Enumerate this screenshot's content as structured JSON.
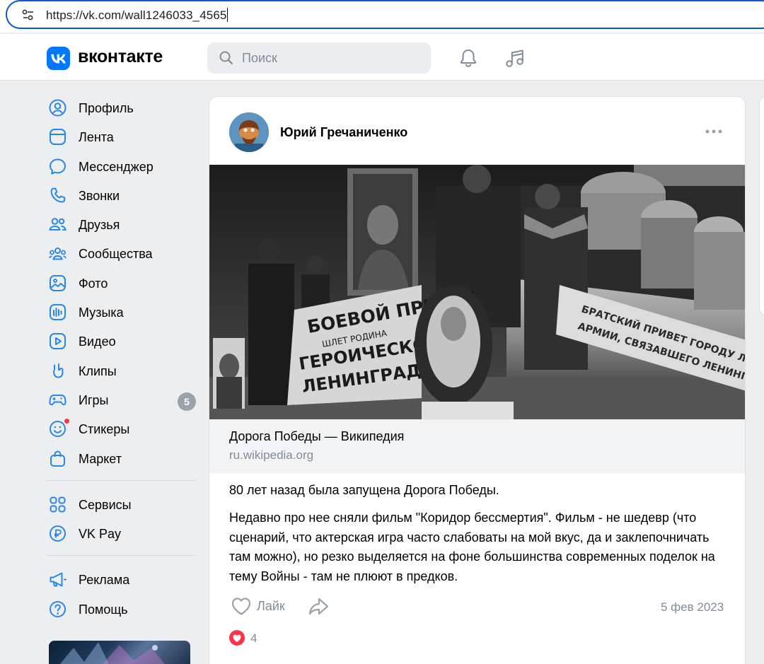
{
  "browser": {
    "url": "https://vk.com/wall1246033_4565"
  },
  "header": {
    "logo_text": "вконтакте",
    "search_placeholder": "Поиск"
  },
  "sidebar": {
    "items": [
      {
        "label": "Профиль",
        "icon": "profile-icon"
      },
      {
        "label": "Лента",
        "icon": "feed-icon"
      },
      {
        "label": "Мессенджер",
        "icon": "messenger-icon"
      },
      {
        "label": "Звонки",
        "icon": "phone-icon"
      },
      {
        "label": "Друзья",
        "icon": "friends-icon"
      },
      {
        "label": "Сообщества",
        "icon": "communities-icon"
      },
      {
        "label": "Фото",
        "icon": "photo-icon"
      },
      {
        "label": "Музыка",
        "icon": "music-icon"
      },
      {
        "label": "Видео",
        "icon": "video-icon"
      },
      {
        "label": "Клипы",
        "icon": "clips-icon"
      },
      {
        "label": "Игры",
        "icon": "games-icon",
        "badge": "5"
      },
      {
        "label": "Стикеры",
        "icon": "stickers-icon"
      },
      {
        "label": "Маркет",
        "icon": "market-icon"
      }
    ],
    "items2": [
      {
        "label": "Сервисы",
        "icon": "services-icon"
      },
      {
        "label": "VK Pay",
        "icon": "vkpay-icon"
      }
    ],
    "items3": [
      {
        "label": "Реклама",
        "icon": "ads-icon"
      },
      {
        "label": "Помощь",
        "icon": "help-icon"
      }
    ]
  },
  "post": {
    "author": "Юрий Гречаниченко",
    "photo_banner_left": "БОЕВОЙ ПРИВЕТ ШЛЕТ РОДИНА ГЕРОИЧЕСКОМУ ЛЕНИНГРАДУ!",
    "photo_banner_right": "БРАТСКИЙ ПРИВЕТ ГОРОДУ ЛЕНИНА И ЖИТЕЛЯМ. АРМИИ, СВЯЗАВШЕГО ЛЕНИНГРАД БОЛЬШОЙ ЗЕМЛЕЙ",
    "link_title": "Дорога Победы — Википедия",
    "link_domain": "ru.wikipedia.org",
    "text_line1": "80 лет назад была запущена Дорога Победы.",
    "text_body": "Недавно про нее сняли фильм \"Коридор бессмертия\". Фильм - не шедевр (что сценарий, что актерская игра часто слабоваты на мой вкус, да и заклепочничать там можно), но резко выделяется на фоне большинства современных поделок на тему Войны - там не плюют в предков.",
    "like_label": "Лайк",
    "date": "5 фев 2023",
    "reaction_count": "4"
  },
  "colors": {
    "accent": "#0077ff",
    "page_bg": "#edeef0",
    "secondary_text": "#818c99",
    "reaction_red": "#ff3347"
  }
}
